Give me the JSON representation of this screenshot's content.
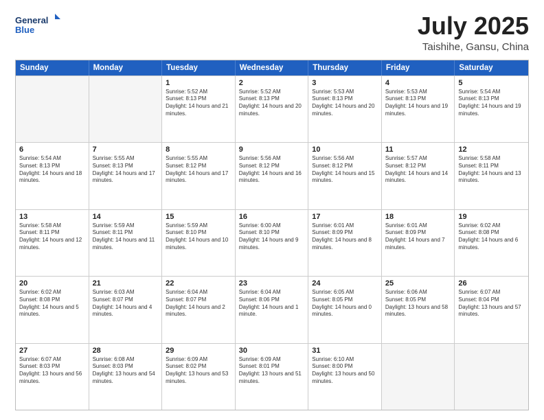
{
  "logo": {
    "line1": "General",
    "line2": "Blue"
  },
  "title": "July 2025",
  "subtitle": "Taishihe, Gansu, China",
  "header_days": [
    "Sunday",
    "Monday",
    "Tuesday",
    "Wednesday",
    "Thursday",
    "Friday",
    "Saturday"
  ],
  "weeks": [
    [
      {
        "day": "",
        "sunrise": "",
        "sunset": "",
        "daylight": ""
      },
      {
        "day": "",
        "sunrise": "",
        "sunset": "",
        "daylight": ""
      },
      {
        "day": "1",
        "sunrise": "Sunrise: 5:52 AM",
        "sunset": "Sunset: 8:13 PM",
        "daylight": "Daylight: 14 hours and 21 minutes."
      },
      {
        "day": "2",
        "sunrise": "Sunrise: 5:52 AM",
        "sunset": "Sunset: 8:13 PM",
        "daylight": "Daylight: 14 hours and 20 minutes."
      },
      {
        "day": "3",
        "sunrise": "Sunrise: 5:53 AM",
        "sunset": "Sunset: 8:13 PM",
        "daylight": "Daylight: 14 hours and 20 minutes."
      },
      {
        "day": "4",
        "sunrise": "Sunrise: 5:53 AM",
        "sunset": "Sunset: 8:13 PM",
        "daylight": "Daylight: 14 hours and 19 minutes."
      },
      {
        "day": "5",
        "sunrise": "Sunrise: 5:54 AM",
        "sunset": "Sunset: 8:13 PM",
        "daylight": "Daylight: 14 hours and 19 minutes."
      }
    ],
    [
      {
        "day": "6",
        "sunrise": "Sunrise: 5:54 AM",
        "sunset": "Sunset: 8:13 PM",
        "daylight": "Daylight: 14 hours and 18 minutes."
      },
      {
        "day": "7",
        "sunrise": "Sunrise: 5:55 AM",
        "sunset": "Sunset: 8:13 PM",
        "daylight": "Daylight: 14 hours and 17 minutes."
      },
      {
        "day": "8",
        "sunrise": "Sunrise: 5:55 AM",
        "sunset": "Sunset: 8:12 PM",
        "daylight": "Daylight: 14 hours and 17 minutes."
      },
      {
        "day": "9",
        "sunrise": "Sunrise: 5:56 AM",
        "sunset": "Sunset: 8:12 PM",
        "daylight": "Daylight: 14 hours and 16 minutes."
      },
      {
        "day": "10",
        "sunrise": "Sunrise: 5:56 AM",
        "sunset": "Sunset: 8:12 PM",
        "daylight": "Daylight: 14 hours and 15 minutes."
      },
      {
        "day": "11",
        "sunrise": "Sunrise: 5:57 AM",
        "sunset": "Sunset: 8:12 PM",
        "daylight": "Daylight: 14 hours and 14 minutes."
      },
      {
        "day": "12",
        "sunrise": "Sunrise: 5:58 AM",
        "sunset": "Sunset: 8:11 PM",
        "daylight": "Daylight: 14 hours and 13 minutes."
      }
    ],
    [
      {
        "day": "13",
        "sunrise": "Sunrise: 5:58 AM",
        "sunset": "Sunset: 8:11 PM",
        "daylight": "Daylight: 14 hours and 12 minutes."
      },
      {
        "day": "14",
        "sunrise": "Sunrise: 5:59 AM",
        "sunset": "Sunset: 8:11 PM",
        "daylight": "Daylight: 14 hours and 11 minutes."
      },
      {
        "day": "15",
        "sunrise": "Sunrise: 5:59 AM",
        "sunset": "Sunset: 8:10 PM",
        "daylight": "Daylight: 14 hours and 10 minutes."
      },
      {
        "day": "16",
        "sunrise": "Sunrise: 6:00 AM",
        "sunset": "Sunset: 8:10 PM",
        "daylight": "Daylight: 14 hours and 9 minutes."
      },
      {
        "day": "17",
        "sunrise": "Sunrise: 6:01 AM",
        "sunset": "Sunset: 8:09 PM",
        "daylight": "Daylight: 14 hours and 8 minutes."
      },
      {
        "day": "18",
        "sunrise": "Sunrise: 6:01 AM",
        "sunset": "Sunset: 8:09 PM",
        "daylight": "Daylight: 14 hours and 7 minutes."
      },
      {
        "day": "19",
        "sunrise": "Sunrise: 6:02 AM",
        "sunset": "Sunset: 8:08 PM",
        "daylight": "Daylight: 14 hours and 6 minutes."
      }
    ],
    [
      {
        "day": "20",
        "sunrise": "Sunrise: 6:02 AM",
        "sunset": "Sunset: 8:08 PM",
        "daylight": "Daylight: 14 hours and 5 minutes."
      },
      {
        "day": "21",
        "sunrise": "Sunrise: 6:03 AM",
        "sunset": "Sunset: 8:07 PM",
        "daylight": "Daylight: 14 hours and 4 minutes."
      },
      {
        "day": "22",
        "sunrise": "Sunrise: 6:04 AM",
        "sunset": "Sunset: 8:07 PM",
        "daylight": "Daylight: 14 hours and 2 minutes."
      },
      {
        "day": "23",
        "sunrise": "Sunrise: 6:04 AM",
        "sunset": "Sunset: 8:06 PM",
        "daylight": "Daylight: 14 hours and 1 minute."
      },
      {
        "day": "24",
        "sunrise": "Sunrise: 6:05 AM",
        "sunset": "Sunset: 8:05 PM",
        "daylight": "Daylight: 14 hours and 0 minutes."
      },
      {
        "day": "25",
        "sunrise": "Sunrise: 6:06 AM",
        "sunset": "Sunset: 8:05 PM",
        "daylight": "Daylight: 13 hours and 58 minutes."
      },
      {
        "day": "26",
        "sunrise": "Sunrise: 6:07 AM",
        "sunset": "Sunset: 8:04 PM",
        "daylight": "Daylight: 13 hours and 57 minutes."
      }
    ],
    [
      {
        "day": "27",
        "sunrise": "Sunrise: 6:07 AM",
        "sunset": "Sunset: 8:03 PM",
        "daylight": "Daylight: 13 hours and 56 minutes."
      },
      {
        "day": "28",
        "sunrise": "Sunrise: 6:08 AM",
        "sunset": "Sunset: 8:03 PM",
        "daylight": "Daylight: 13 hours and 54 minutes."
      },
      {
        "day": "29",
        "sunrise": "Sunrise: 6:09 AM",
        "sunset": "Sunset: 8:02 PM",
        "daylight": "Daylight: 13 hours and 53 minutes."
      },
      {
        "day": "30",
        "sunrise": "Sunrise: 6:09 AM",
        "sunset": "Sunset: 8:01 PM",
        "daylight": "Daylight: 13 hours and 51 minutes."
      },
      {
        "day": "31",
        "sunrise": "Sunrise: 6:10 AM",
        "sunset": "Sunset: 8:00 PM",
        "daylight": "Daylight: 13 hours and 50 minutes."
      },
      {
        "day": "",
        "sunrise": "",
        "sunset": "",
        "daylight": ""
      },
      {
        "day": "",
        "sunrise": "",
        "sunset": "",
        "daylight": ""
      }
    ]
  ]
}
